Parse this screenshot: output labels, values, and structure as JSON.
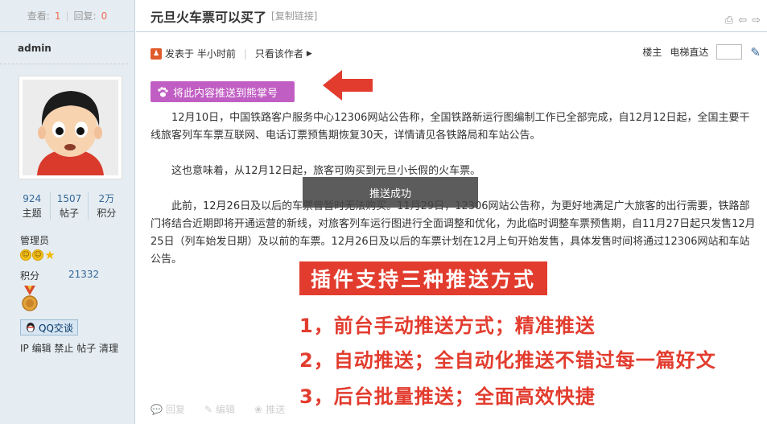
{
  "left": {
    "views_label": "查看:",
    "views": "1",
    "replies_label": "回复:",
    "replies": "0",
    "author": "admin",
    "counts": [
      {
        "n": "924",
        "l": "主题"
      },
      {
        "n": "1507",
        "l": "帖子"
      },
      {
        "n": "2万",
        "l": "积分"
      }
    ],
    "role": "管理员",
    "credit_label": "积分",
    "credit_value": "21332",
    "qq_label": "QQ交谈",
    "ip_line": "IP 编辑 禁止 帖子 清理"
  },
  "main": {
    "title": "元旦火车票可以买了",
    "copy_link": "[复制链接]",
    "posted": "发表于 半小时前",
    "only_author": "只看该作者",
    "floor_label": "楼主",
    "jump_label": "电梯直达",
    "push_button": "将此内容推送到熊掌号",
    "paragraphs": [
      "12月10日，中国铁路客户服务中心12306网站公告称，全国铁路新运行图编制工作已全部完成，自12月12日起，全国主要干线旅客列车车票互联网、电话订票预售期恢复30天，详情请见各铁路局和车站公告。",
      "这也意味着，从12月12日起，旅客可购买到元旦小长假的火车票。",
      "此前，12月26日及以后的车票曾暂时无法购买。11月29日，12306网站公告称，为更好地满足广大旅客的出行需要，铁路部门将结合近期即将开通运营的新线，对旅客列车运行图进行全面调整和优化，为此临时调整车票预售期，自11月27日起只发售12月25日（列车始发日期）及以前的车票。12月26日及以后的车票计划在12月上旬开始发售，具体发售时间将通过12306网站和车站公告。"
    ],
    "toast": "推送成功",
    "promo_title": "插件支持三种推送方式",
    "promo_lines": [
      "1，前台手动推送方式；精准推送",
      "2，自动推送；全自动化推送不错过每一篇好文",
      "3，后台批量推送；全面高效快捷"
    ],
    "actions": [
      "回复",
      "编辑",
      "推送"
    ]
  },
  "colors": {
    "accent": "#e23c2e",
    "push_button": "#c15ec4",
    "sidebar_bg": "#e5edf2"
  }
}
